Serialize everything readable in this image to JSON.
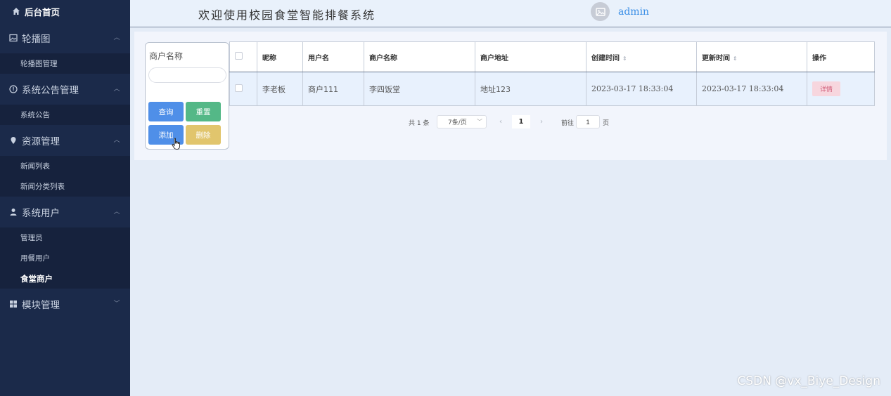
{
  "sidebar": {
    "home": "后台首页",
    "groups": [
      {
        "label": "轮播图",
        "icon": "image-icon",
        "items": [
          "轮播图管理"
        ]
      },
      {
        "label": "系统公告管理",
        "icon": "info-circle-icon",
        "items": [
          "系统公告"
        ]
      },
      {
        "label": "资源管理",
        "icon": "location-pin-icon",
        "items": [
          "新闻列表",
          "新闻分类列表"
        ]
      },
      {
        "label": "系统用户",
        "icon": "user-icon",
        "items": [
          "管理员",
          "用餐用户",
          "食堂商户"
        ]
      },
      {
        "label": "模块管理",
        "icon": "grid-icon",
        "items": []
      }
    ],
    "active_item": "食堂商户"
  },
  "header": {
    "title": "欢迎使用校园食堂智能排餐系统",
    "username": "admin"
  },
  "search": {
    "label": "商户名称",
    "value": "",
    "query_button": "查询",
    "reset_button": "重置",
    "add_button": "添加",
    "delete_button": "删除"
  },
  "table": {
    "columns": [
      "昵称",
      "用户名",
      "商户名称",
      "商户地址",
      "创建时间",
      "更新时间",
      "操作"
    ],
    "rows": [
      {
        "nickname": "李老板",
        "username": "商户111",
        "merchant_name": "李四饭堂",
        "address": "地址123",
        "created": "2023-03-17 18:33:04",
        "updated": "2023-03-17 18:33:04",
        "action": "详情"
      }
    ]
  },
  "pagination": {
    "total_text": "共 1 条",
    "page_size": "7条/页",
    "current_page": "1",
    "goto_label": "前往",
    "goto_value": "1",
    "page_suffix": "页"
  },
  "watermark": "CSDN @vx_Biye_Design",
  "colors": {
    "sidebar_bg": "#1b2a4a",
    "primary": "#4f8fe8",
    "success": "#54b887",
    "warning": "#e1c56d",
    "detail_bg": "#f7d6de"
  }
}
